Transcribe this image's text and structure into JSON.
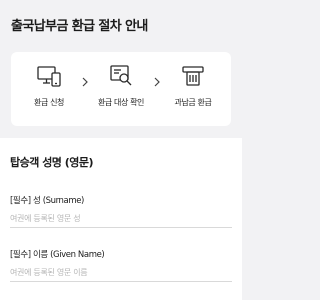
{
  "page": {
    "title": "출국납부금 환급 절차 안내"
  },
  "steps": [
    {
      "label": "환급 신청",
      "icon": "devices-icon"
    },
    {
      "label": "환급 대상 확인",
      "icon": "document-search-icon"
    },
    {
      "label": "과납금 환급",
      "icon": "atm-cash-icon"
    }
  ],
  "form": {
    "section_title": "탑승객 성명 (영문)",
    "surname": {
      "label": "[필수] 성 (Surname)",
      "placeholder": "여권에 등록된 영문 성",
      "value": ""
    },
    "given_name": {
      "label": "[필수] 이름 (Given Name)",
      "placeholder": "여권에 등록된 영문 이름",
      "value": ""
    }
  },
  "colors": {
    "background": "#f2f2f4",
    "card": "#ffffff",
    "text": "#1b1b1b",
    "placeholder": "#b5b5b5",
    "divider": "#d9d9d9"
  }
}
